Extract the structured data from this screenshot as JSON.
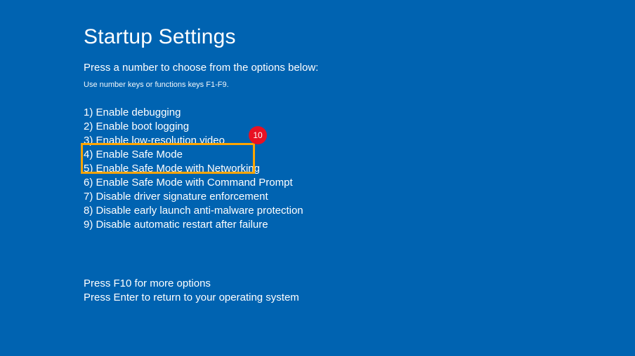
{
  "title": "Startup Settings",
  "subtitle": "Press a number to choose from the options below:",
  "hint": "Use number keys or functions keys F1-F9.",
  "options": [
    "1) Enable debugging",
    "2) Enable boot logging",
    "3) Enable low-resolution video",
    "4) Enable Safe Mode",
    "5) Enable Safe Mode with Networking",
    "6) Enable Safe Mode with Command Prompt",
    "7) Disable driver signature enforcement",
    "8) Disable early launch anti-malware protection",
    "9) Disable automatic restart after failure"
  ],
  "footer": {
    "line1": "Press F10 for more options",
    "line2": "Press Enter to return to your operating system"
  },
  "annotation": {
    "badge": "10"
  }
}
